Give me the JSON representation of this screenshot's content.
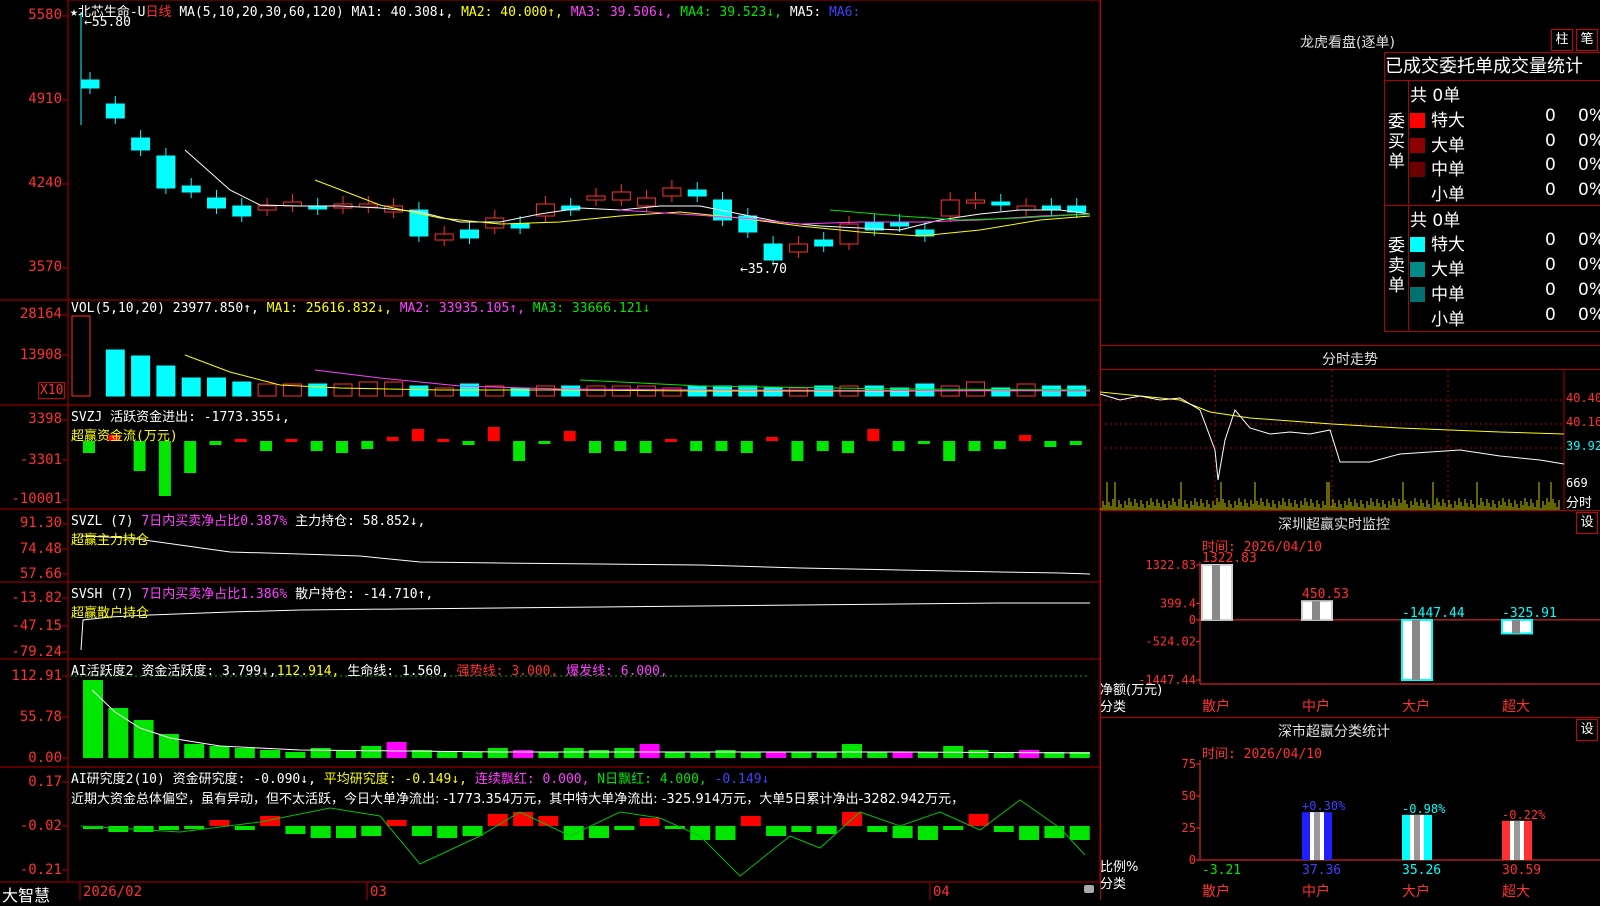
{
  "stock": {
    "name": "北芯生命-U",
    "period": "日线",
    "star": "★"
  },
  "main": {
    "ma_title": "MA(5,10,20,30,60,120)",
    "ma1": "MA1: 40.308↓,",
    "ma2": "MA2: 40.000↑,",
    "ma3": "MA3: 39.506↓,",
    "ma4": "MA4: 39.523↓,",
    "ma5": "MA5:",
    "ma6": "MA6:",
    "high_label": "55.80",
    "low_label": "35.70",
    "y_labels": [
      "5580",
      "4910",
      "4240",
      "3570"
    ]
  },
  "vol": {
    "title": "VOL(5,10,20)",
    "value": "23977.850↑,",
    "ma1": "MA1: 25616.832↓,",
    "ma2": "MA2: 33935.105↑,",
    "ma3": "MA3: 33666.121↓",
    "y_labels": [
      "28164",
      "13908"
    ],
    "unit": "X10"
  },
  "svzj": {
    "title": "SVZJ  活跃资金进出: -1773.355↓,",
    "subtitle": "超赢资金流(万元)",
    "y_labels": [
      "3398",
      "-3301",
      "-10001"
    ]
  },
  "svzl": {
    "title": "SVZL (7)",
    "part1": "7日内买卖净占比0.387%",
    "part2": "主力持仓: 58.852↓,",
    "subtitle": "超赢主力持仓",
    "y_labels": [
      "91.30",
      "74.48",
      "57.66"
    ]
  },
  "svsh": {
    "title": "SVSH (7)",
    "part1": "7日内买卖净占比1.386%",
    "part2": "散户持仓: -14.710↑,",
    "subtitle": "超赢散户持仓",
    "y_labels": [
      "-13.82",
      "-47.15",
      "-79.24"
    ]
  },
  "ai1": {
    "title": "AI活跃度2",
    "p1": "资金活跃度: 3.799↓,",
    "p2": "112.914,",
    "p3": "生命线: 1.560,",
    "p4": "强势线: 3.000,",
    "p5": "爆发线: 6.000,",
    "y_labels": [
      "112.91",
      "55.78",
      "0.00"
    ]
  },
  "ai2": {
    "title": "AI研究度2(10)",
    "p1": "资金研究度: -0.090↓,",
    "p2": "平均研究度: -0.149↓,",
    "p3": "连续飘红: 0.000,",
    "p4": "N日飘红: 4.000,",
    "p5": "-0.149↓",
    "comment": "近期大资金总体偏空，虽有异动，但不太活跃，今日大单净流出: -1773.354万元，其中特大单净流出: -325.914万元，大单5日累计净出-3282.942万元，",
    "y_labels": [
      "0.17",
      "-0.02",
      "-0.21"
    ]
  },
  "dates": {
    "logo": "大智慧",
    "d1": "2026/02",
    "d2": "03",
    "d3": "04"
  },
  "panel": {
    "title": "龙虎看盘(逐单)",
    "btn1": "柱",
    "btn2": "笔",
    "subtitle": "已成交委托单成交量统计",
    "buy": {
      "side": "委买单",
      "total": "共 0单",
      "rows": [
        {
          "label": "特大",
          "n": "0",
          "p": "0%",
          "color": "#ff0000"
        },
        {
          "label": "大单",
          "n": "0",
          "p": "0%",
          "color": "#8b0000"
        },
        {
          "label": "中单",
          "n": "0",
          "p": "0%",
          "color": "#6a0000"
        },
        {
          "label": "小单",
          "n": "0",
          "p": "0%",
          "color": "#000000"
        }
      ]
    },
    "sell": {
      "side": "委卖单",
      "total": "共 0单",
      "rows": [
        {
          "label": "特大",
          "n": "0",
          "p": "0%",
          "color": "#00ffff"
        },
        {
          "label": "大单",
          "n": "0",
          "p": "0%",
          "color": "#008b8b"
        },
        {
          "label": "中单",
          "n": "0",
          "p": "0%",
          "color": "#007070"
        },
        {
          "label": "小单",
          "n": "0",
          "p": "0%",
          "color": "#000000"
        }
      ]
    }
  },
  "intraday": {
    "title": "分时走势",
    "y_labels": [
      "40.40",
      "40.16",
      "39.92"
    ],
    "vol_label": "669",
    "unit": "分时"
  },
  "monitor": {
    "title": "深圳超赢实时监控",
    "set": "设",
    "time": "时间: 2026/04/10",
    "y_labels": [
      "1322.83",
      "399.4",
      "0",
      "-524.02",
      "-1447.44"
    ],
    "y_title": "净额(万元)",
    "x_title": "分类"
  },
  "classify": {
    "title": "深市超赢分类统计",
    "set": "设",
    "time": "时间: 2026/04/10",
    "y_labels": [
      "75",
      "50",
      "25",
      "0"
    ],
    "y_title": "比例%",
    "x_title": "分类"
  },
  "chart_data": [
    {
      "type": "bar",
      "title": "深圳超赢实时监控",
      "categories": [
        "散户",
        "中户",
        "大户",
        "超大"
      ],
      "values": [
        1322.83,
        450.53,
        -1447.44,
        -325.91
      ],
      "ylabel": "净额(万元)",
      "ylim": [
        -1447.44,
        1322.83
      ]
    },
    {
      "type": "bar",
      "title": "深市超赢分类统计",
      "categories": [
        "散户",
        "中户",
        "大户",
        "超大"
      ],
      "values": [
        -3.21,
        37.36,
        35.26,
        30.59
      ],
      "changes": [
        "",
        "+0.30%",
        "-0.98%",
        "-0.22%"
      ],
      "ylabel": "比例%",
      "ylim": [
        0,
        75
      ]
    }
  ]
}
